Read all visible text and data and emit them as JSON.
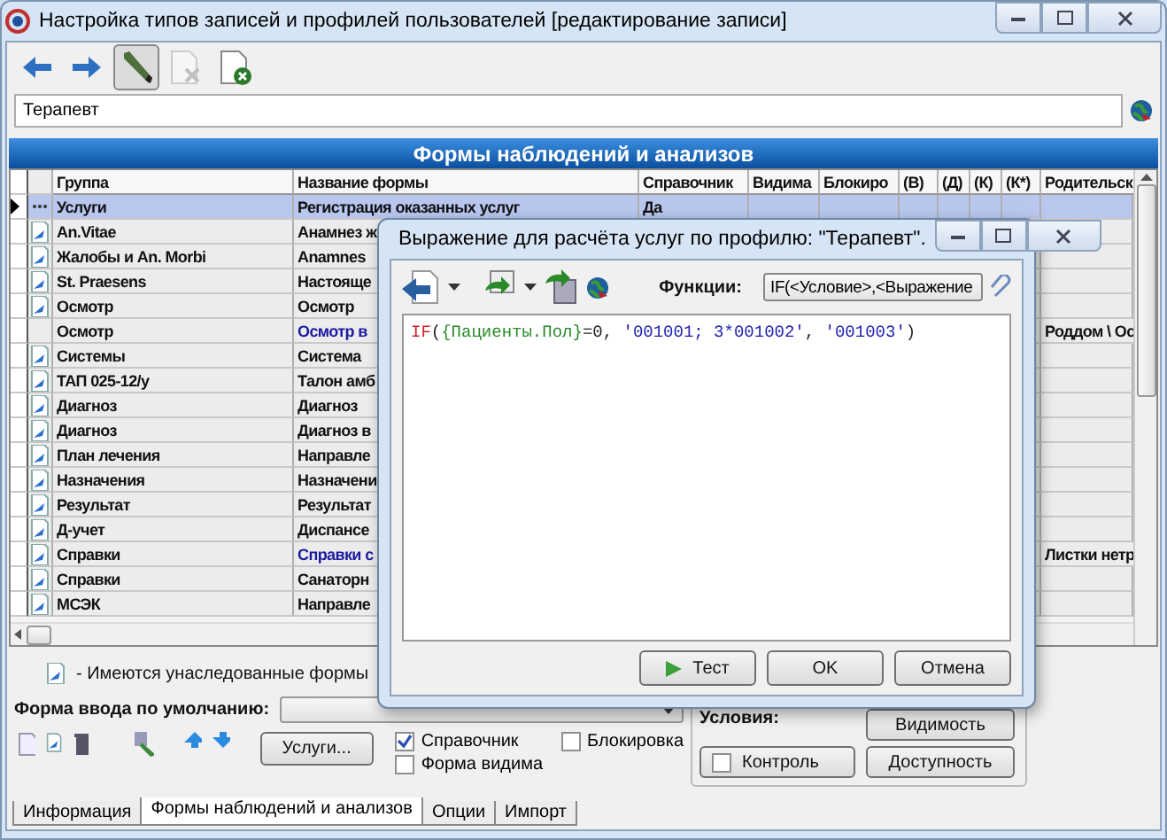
{
  "window": {
    "title": "Настройка типов записей и профилей пользователей [редактирование записи]"
  },
  "toolbar": [
    {
      "kind": "back",
      "pressed": false,
      "disabled": false
    },
    {
      "kind": "forward",
      "pressed": false,
      "disabled": false
    },
    {
      "kind": "edit",
      "pressed": true,
      "disabled": false
    },
    {
      "kind": "delete",
      "pressed": false,
      "disabled": true
    },
    {
      "kind": "remove",
      "pressed": false,
      "disabled": false
    }
  ],
  "profile": {
    "value": "Терапевт"
  },
  "section": {
    "title": "Формы наблюдений и анализов"
  },
  "table": {
    "columns": [
      "Группа",
      "Название формы",
      "Справочник",
      "Видима",
      "Блокиро",
      "(В)",
      "(Д)",
      "(К)",
      "(К*)",
      "Родительск"
    ],
    "rows": [
      {
        "group": "Услуги",
        "form": "Регистрация оказанных услуг",
        "reference": "Да",
        "selected": true,
        "inherited": false,
        "accent": false
      },
      {
        "group": "An.Vitae",
        "form": "Анамнез ж",
        "selected": false,
        "inherited": true,
        "accent": false
      },
      {
        "group": "Жалобы и An. Morbi",
        "form": "Anamnes",
        "selected": false,
        "inherited": true,
        "accent": false
      },
      {
        "group": "St. Praesens",
        "form": "Настояще",
        "selected": false,
        "inherited": true,
        "accent": false
      },
      {
        "group": "Осмотр",
        "form": "Осмотр",
        "selected": false,
        "inherited": true,
        "accent": false
      },
      {
        "group": "Осмотр",
        "form": "Осмотр в",
        "parent": "Роддом \\ Ос",
        "selected": false,
        "inherited": false,
        "accent": true
      },
      {
        "group": "Системы",
        "form": "Система",
        "selected": false,
        "inherited": true,
        "accent": false
      },
      {
        "group": "ТАП 025-12/у",
        "form": "Талон амб",
        "selected": false,
        "inherited": true,
        "accent": false
      },
      {
        "group": "Диагноз",
        "form": "Диагноз",
        "selected": false,
        "inherited": true,
        "accent": false
      },
      {
        "group": "Диагноз",
        "form": "Диагноз в",
        "selected": false,
        "inherited": true,
        "accent": false
      },
      {
        "group": "План лечения",
        "form": "Направле",
        "selected": false,
        "inherited": true,
        "accent": false
      },
      {
        "group": "Назначения",
        "form": "Назначени",
        "selected": false,
        "inherited": true,
        "accent": false
      },
      {
        "group": "Результат",
        "form": "Результат",
        "selected": false,
        "inherited": true,
        "accent": false
      },
      {
        "group": "Д-учет",
        "form": "Диспансе",
        "selected": false,
        "inherited": true,
        "accent": false
      },
      {
        "group": "Справки",
        "form": "Справки с",
        "parent": "Листки нетр",
        "selected": false,
        "inherited": true,
        "accent": true
      },
      {
        "group": "Справки",
        "form": "Санаторн",
        "selected": false,
        "inherited": true,
        "accent": false
      },
      {
        "group": "МСЭК",
        "form": "Направле",
        "selected": false,
        "inherited": true,
        "accent": false
      }
    ]
  },
  "legend": "- Имеются унаследованные формы",
  "default_form": {
    "label": "Форма ввода по умолчанию:"
  },
  "services_button": "Услуги...",
  "checkboxes": [
    {
      "label": "Справочник",
      "checked": true
    },
    {
      "label": "Форма видима",
      "checked": false
    },
    {
      "label": "Блокировка",
      "checked": false
    }
  ],
  "conditions": {
    "label": "Условия:",
    "buttons": [
      {
        "label": "Видимость",
        "kind": "plain"
      },
      {
        "label": "Контроль",
        "kind": "checkbox",
        "checked": false
      },
      {
        "label": "Доступность",
        "kind": "plain"
      }
    ]
  },
  "tabs": [
    {
      "label": "Информация",
      "selected": false
    },
    {
      "label": "Формы наблюдений и анализов",
      "selected": true
    },
    {
      "label": "Опции",
      "selected": false
    },
    {
      "label": "Импорт",
      "selected": false
    }
  ],
  "dialog": {
    "title": "Выражение для расчёта услуг по профилю: \"Терапевт\".",
    "functions_label": "Функции:",
    "function": "IF(<Условие>,<Выражение",
    "code": [
      {
        "kind": "keyword",
        "text": "IF"
      },
      {
        "kind": "plain",
        "text": "("
      },
      {
        "kind": "field",
        "text": "{Пациенты.Пол}"
      },
      {
        "kind": "plain",
        "text": "=0, "
      },
      {
        "kind": "string",
        "text": "'001001; 3*001002'"
      },
      {
        "kind": "plain",
        "text": ", "
      },
      {
        "kind": "string",
        "text": "'001003'"
      },
      {
        "kind": "plain",
        "text": ")"
      }
    ],
    "buttons": [
      {
        "label": "Тест",
        "kind": "test"
      },
      {
        "label": "OK",
        "kind": "plain"
      },
      {
        "label": "Отмена",
        "kind": "plain"
      }
    ]
  }
}
